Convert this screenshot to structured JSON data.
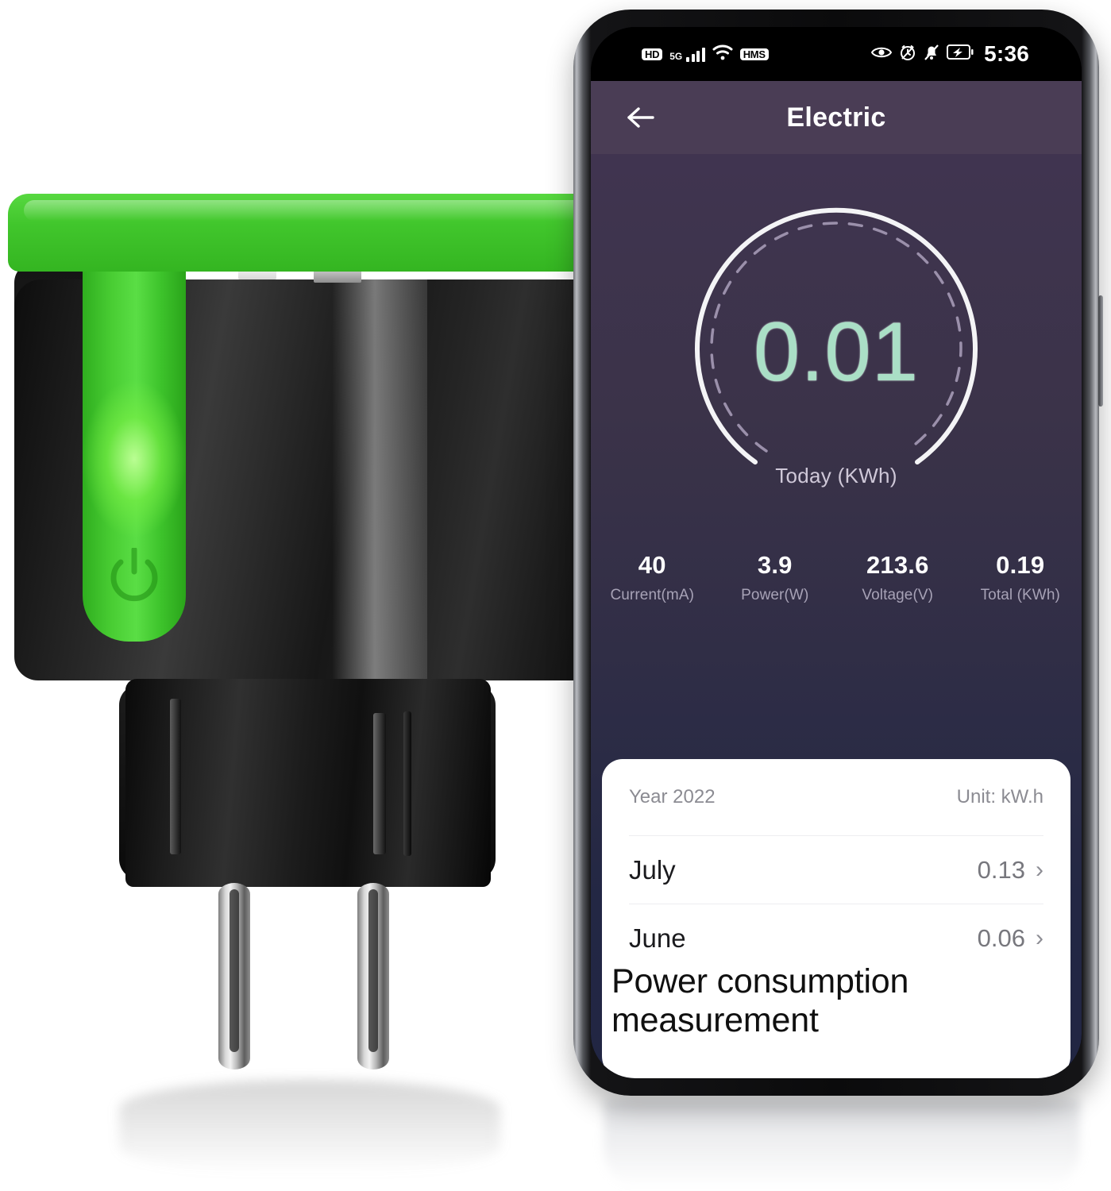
{
  "product": {
    "name": "smart-plug",
    "cap_color": "#3dc22a",
    "body_color": "#1a1a1a",
    "indicator_icon": "power-icon",
    "indicator_state": "on"
  },
  "phone": {
    "status_bar": {
      "left_icons": [
        "hd-badge-icon",
        "5g-signal-icon",
        "wifi-icon",
        "hms-badge-icon"
      ],
      "hd_label": "HD",
      "network_label": "5G",
      "hms_label": "HMS",
      "right_icons": [
        "eye-icon",
        "alarm-icon",
        "mute-bell-icon",
        "battery-charging-icon"
      ],
      "time": "5:36"
    },
    "header": {
      "back_icon": "back-arrow-icon",
      "title": "Electric",
      "background": "#4a3d55"
    },
    "gauge": {
      "value": "0.01",
      "label": "Today (KWh)",
      "value_color": "#aadfc6",
      "ring_color": "#f2f2f2",
      "dashed_ring_color": "#9b90ab"
    },
    "metrics": [
      {
        "value": "40",
        "label": "Current(mA)"
      },
      {
        "value": "3.9",
        "label": "Power(W)"
      },
      {
        "value": "213.6",
        "label": "Voltage(V)"
      },
      {
        "value": "0.19",
        "label": "Total (KWh)"
      }
    ],
    "card": {
      "year_label": "Year 2022",
      "unit_label": "Unit: kW.h",
      "rows": [
        {
          "month": "July",
          "value": "0.13",
          "chevron": "›"
        },
        {
          "month": "June",
          "value": "0.06",
          "chevron": "›"
        }
      ]
    }
  },
  "caption": {
    "line1": "Power consumption",
    "line2": "measurement"
  },
  "chart_data": {
    "type": "table",
    "title": "Year 2022",
    "ylabel": "kW.h",
    "categories": [
      "July",
      "June"
    ],
    "values": [
      0.13,
      0.06
    ],
    "annotations": {
      "today_kwh": 0.01,
      "current_mA": 40,
      "power_W": 3.9,
      "voltage_V": 213.6,
      "total_kWh": 0.19
    }
  }
}
